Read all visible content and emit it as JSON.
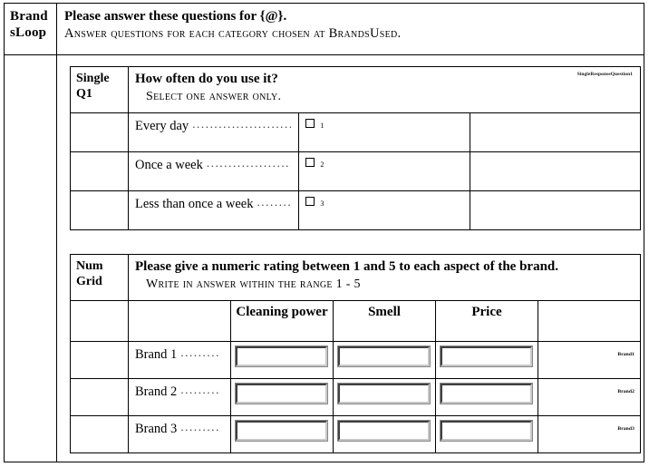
{
  "form": {
    "loop_label_line1": "Brand",
    "loop_label_line2": "sLoop",
    "intro_bold": "Please answer these questions for {@}.",
    "intro_instruction": "Answer questions for each category chosen at BrandsUsed."
  },
  "question_single": {
    "type_label": "Single",
    "code_label": "Q1",
    "text": "How often do you use it?",
    "instruction": "Select one answer only.",
    "variable_name": "SingleResponseQuestion1",
    "leader_dots": "...........................................................................................",
    "answers": [
      {
        "label": "Every day",
        "code": "1"
      },
      {
        "label": "Once a week",
        "code": "2"
      },
      {
        "label": "Less than once a week",
        "code": "3"
      }
    ]
  },
  "question_grid": {
    "type_label_line1": "Num",
    "type_label_line2": "Grid",
    "text": "Please give a numeric rating between 1 and 5 to each aspect of the brand.",
    "instruction": "Write in answer within the range   1 - 5",
    "columns": [
      "Cleaning power",
      "Smell",
      "Price"
    ],
    "leader_dots": ".........",
    "rows": [
      {
        "label": "Brand 1",
        "variable_name": "Brand1",
        "values": [
          "",
          "",
          ""
        ]
      },
      {
        "label": "Brand 2",
        "variable_name": "Brand2",
        "values": [
          "",
          "",
          ""
        ]
      },
      {
        "label": "Brand 3",
        "variable_name": "Brand3",
        "values": [
          "",
          "",
          ""
        ]
      }
    ]
  }
}
